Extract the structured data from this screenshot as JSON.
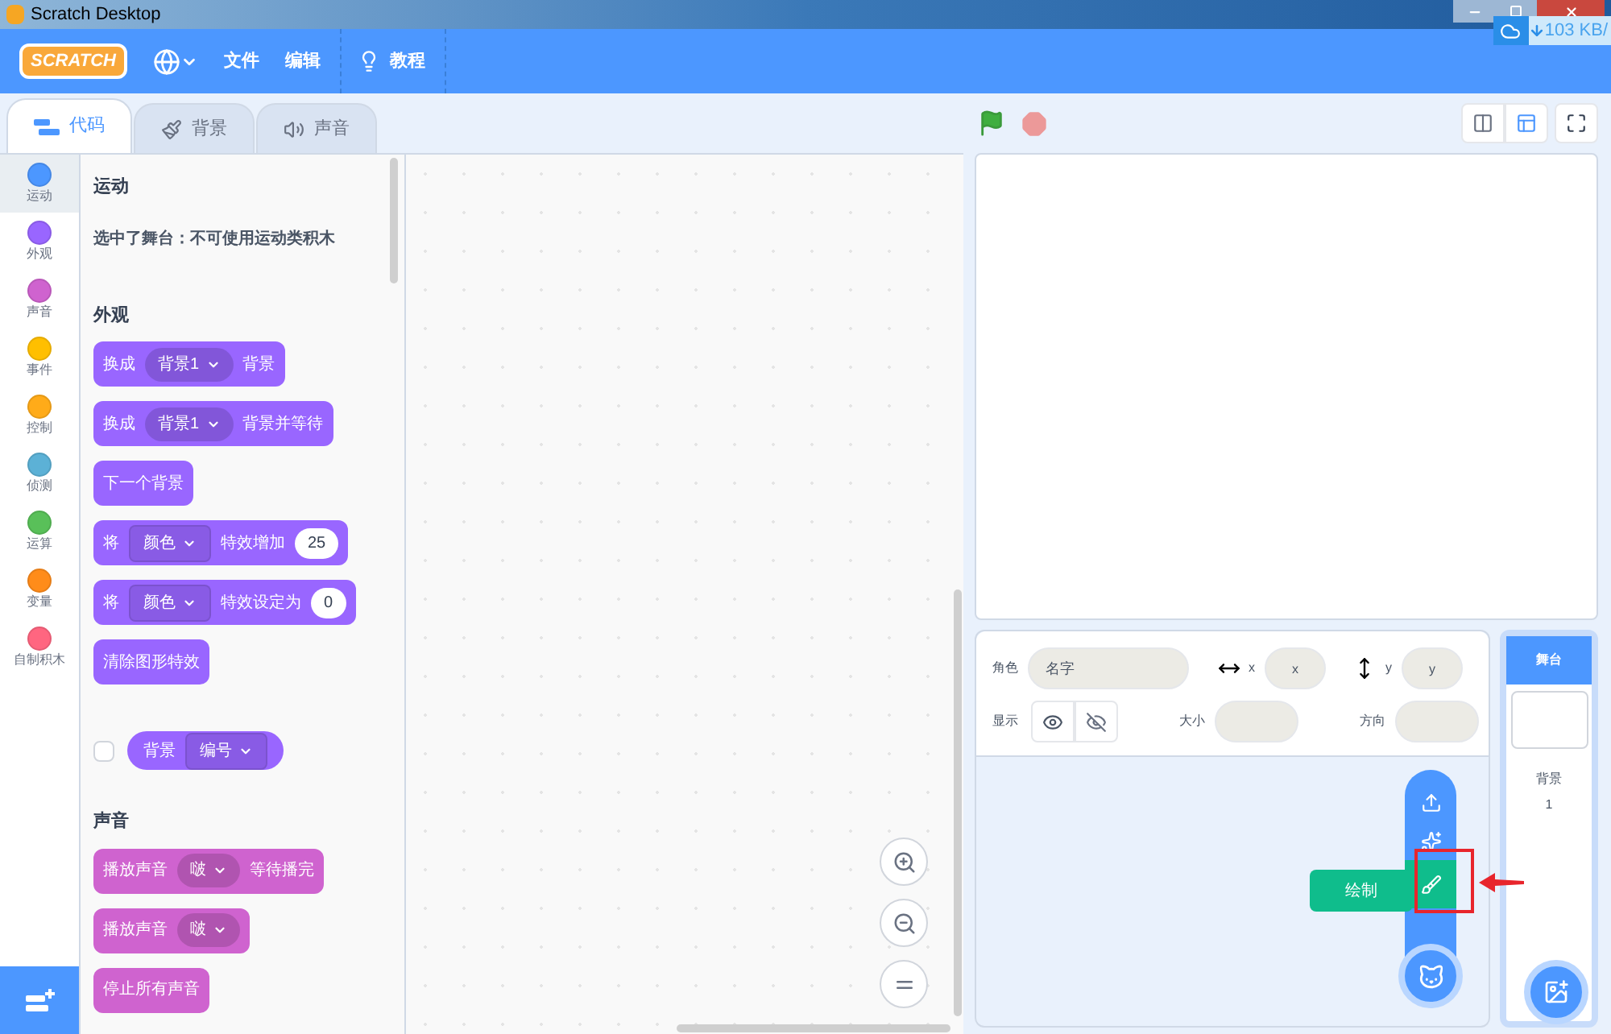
{
  "window": {
    "title": "Scratch Desktop"
  },
  "net_widget": {
    "speed": "103 KB/"
  },
  "menu_bar": {
    "logo": "SCRATCH",
    "items": [
      "文件",
      "编辑"
    ],
    "tutorial": "教程"
  },
  "tabs": [
    {
      "label": "代码",
      "selected": true
    },
    {
      "label": "背景",
      "selected": false
    },
    {
      "label": "声音",
      "selected": false
    }
  ],
  "categories": [
    {
      "label": "运动",
      "color": "#4c97ff",
      "selected": true
    },
    {
      "label": "外观",
      "color": "#9966ff",
      "selected": false
    },
    {
      "label": "声音",
      "color": "#cf63cf",
      "selected": false
    },
    {
      "label": "事件",
      "color": "#ffbf00",
      "selected": false
    },
    {
      "label": "控制",
      "color": "#ffab19",
      "selected": false
    },
    {
      "label": "侦测",
      "color": "#5cb1d6",
      "selected": false
    },
    {
      "label": "运算",
      "color": "#59c059",
      "selected": false
    },
    {
      "label": "变量",
      "color": "#ff8c1a",
      "selected": false
    },
    {
      "label": "自制积木",
      "color": "#ff6680",
      "selected": false
    }
  ],
  "palette": [
    {
      "kind": "heading",
      "text": "运动"
    },
    {
      "kind": "note",
      "text": "选中了舞台：不可使用运动类积木"
    },
    {
      "kind": "heading",
      "text": "外观"
    },
    {
      "kind": "stack",
      "color": "#9966ff",
      "parts": [
        {
          "kind": "text",
          "text": "换成"
        },
        {
          "kind": "dropdown",
          "text": "背景1"
        },
        {
          "kind": "text",
          "text": "背景"
        }
      ]
    },
    {
      "kind": "stack",
      "color": "#9966ff",
      "parts": [
        {
          "kind": "text",
          "text": "换成"
        },
        {
          "kind": "dropdown",
          "text": "背景1"
        },
        {
          "kind": "text",
          "text": "背景并等待"
        }
      ]
    },
    {
      "kind": "stack",
      "color": "#9966ff",
      "parts": [
        {
          "kind": "text",
          "text": "下一个背景"
        }
      ]
    },
    {
      "kind": "stack",
      "color": "#9966ff",
      "parts": [
        {
          "kind": "text",
          "text": "将"
        },
        {
          "kind": "menu",
          "text": "颜色"
        },
        {
          "kind": "text",
          "text": "特效增加"
        },
        {
          "kind": "number",
          "text": "25"
        }
      ]
    },
    {
      "kind": "stack",
      "color": "#9966ff",
      "parts": [
        {
          "kind": "text",
          "text": "将"
        },
        {
          "kind": "menu",
          "text": "颜色"
        },
        {
          "kind": "text",
          "text": "特效设定为"
        },
        {
          "kind": "number",
          "text": "0"
        }
      ]
    },
    {
      "kind": "stack",
      "color": "#9966ff",
      "parts": [
        {
          "kind": "text",
          "text": "清除图形特效"
        }
      ]
    },
    {
      "kind": "reporter",
      "color": "#9966ff",
      "checked": false,
      "parts": [
        {
          "kind": "text",
          "text": "背景"
        },
        {
          "kind": "menu",
          "text": "编号"
        }
      ]
    },
    {
      "kind": "heading",
      "text": "声音"
    },
    {
      "kind": "stack",
      "color": "#cf63cf",
      "parts": [
        {
          "kind": "text",
          "text": "播放声音"
        },
        {
          "kind": "dropdown",
          "text": "啵"
        },
        {
          "kind": "text",
          "text": "等待播完"
        }
      ]
    },
    {
      "kind": "stack",
      "color": "#cf63cf",
      "parts": [
        {
          "kind": "text",
          "text": "播放声音"
        },
        {
          "kind": "dropdown",
          "text": "啵"
        }
      ]
    },
    {
      "kind": "stack",
      "color": "#cf63cf",
      "parts": [
        {
          "kind": "text",
          "text": "停止所有声音"
        }
      ]
    }
  ],
  "sprite_info": {
    "sprite_label": "角色",
    "name_placeholder": "名字",
    "x_label": "x",
    "x_placeholder": "x",
    "y_label": "y",
    "y_placeholder": "y",
    "show_label": "显示",
    "size_label": "大小",
    "direction_label": "方向"
  },
  "sprite_menu": {
    "tooltip": "绘制"
  },
  "stage_pane": {
    "header": "舞台",
    "backdrops_label": "背景",
    "backdrops_count": "1"
  }
}
